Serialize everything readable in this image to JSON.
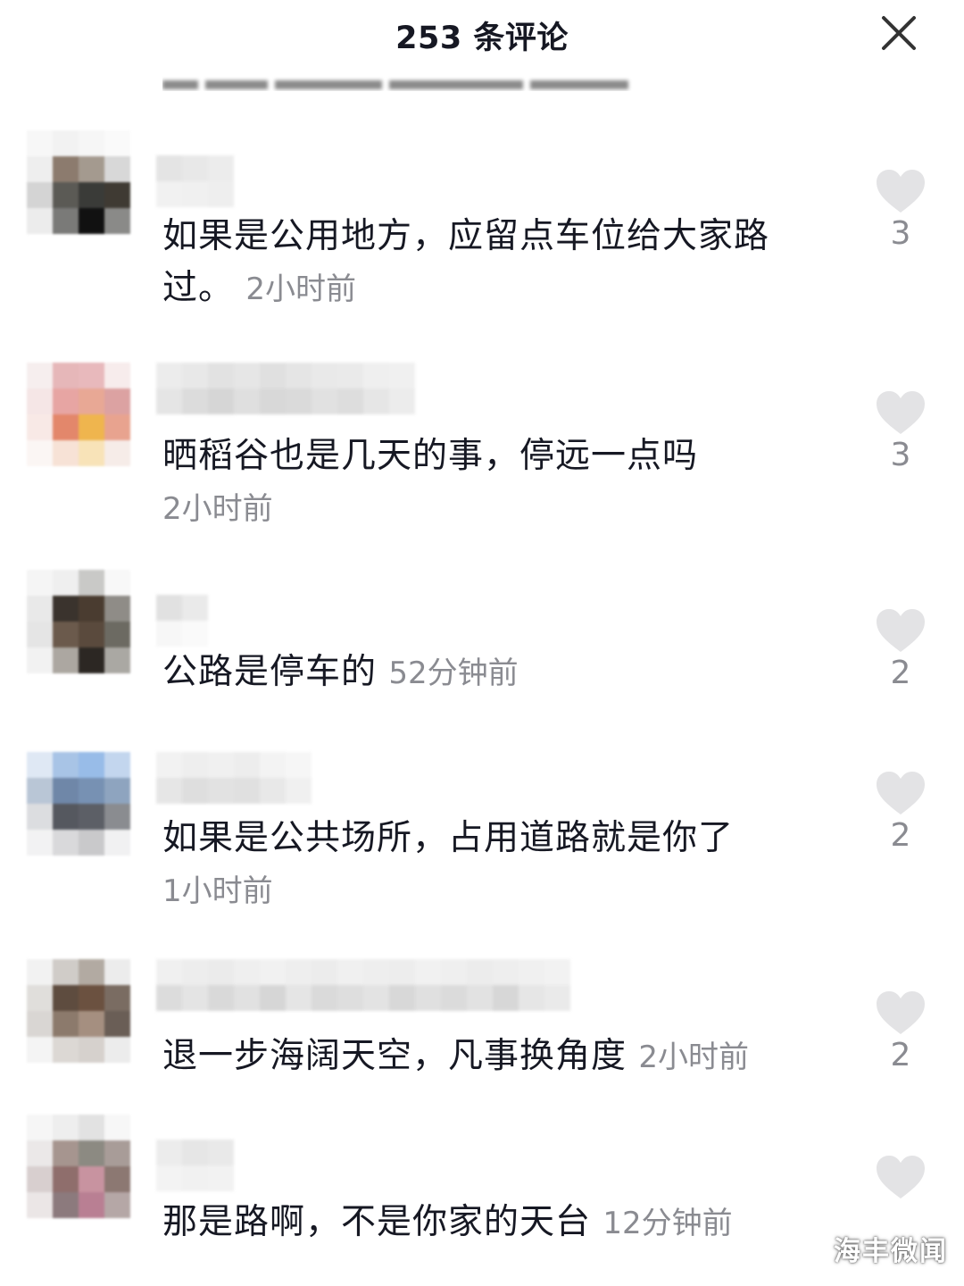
{
  "header": {
    "title": "253 条评论",
    "close_icon": "close-icon"
  },
  "comments": [
    {
      "text": "如果是公用地方，应留点车位给大家路过。",
      "time": "2小时前",
      "likes": "3"
    },
    {
      "text": "晒稻谷也是几天的事，停远一点吗",
      "time": "2小时前",
      "likes": "3"
    },
    {
      "text": "公路是停车的",
      "time": "52分钟前",
      "likes": "2"
    },
    {
      "text": "如果是公共场所，占用道路就是你了",
      "time": "1小时前",
      "likes": "2"
    },
    {
      "text": "退一步海阔天空，凡事换角度",
      "time": "2小时前",
      "likes": "2"
    },
    {
      "text": "那是路啊，不是你家的天台",
      "time": "12分钟前",
      "likes": ""
    }
  ],
  "watermark": "海丰微闻",
  "colors": {
    "text": "#161823",
    "secondary": "#8a8b91",
    "like_icon": "#e3e3e5"
  }
}
